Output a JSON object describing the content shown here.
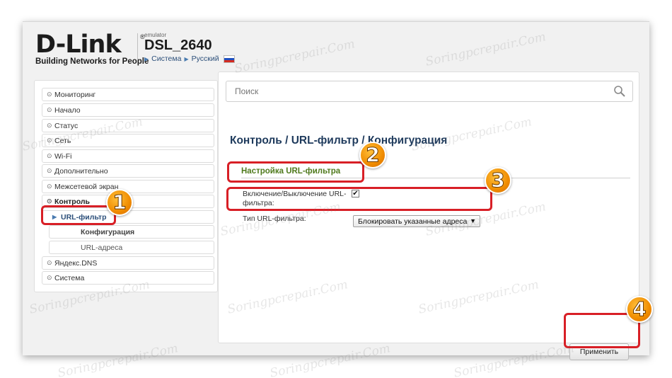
{
  "header": {
    "logo_text": "D-Link",
    "logo_reg": "®",
    "tagline": "Building Networks for People",
    "emulator_label": "emulator",
    "model": "DSL_2640",
    "links": [
      "Система",
      "Русский"
    ]
  },
  "search": {
    "placeholder": "Поиск"
  },
  "sidebar": {
    "items": [
      {
        "label": "Мониторинг"
      },
      {
        "label": "Начало"
      },
      {
        "label": "Статус"
      },
      {
        "label": "Сеть"
      },
      {
        "label": "Wi-Fi"
      },
      {
        "label": "Дополнительно"
      },
      {
        "label": "Межсетевой экран"
      },
      {
        "label": "Контроль"
      }
    ],
    "sub_item": "URL-фильтр",
    "sub_sub_items": [
      "Конфигурация",
      "URL-адреса"
    ],
    "items_after": [
      {
        "label": "Яндекс.DNS"
      },
      {
        "label": "Система"
      }
    ]
  },
  "main": {
    "title": "Контроль /  URL-фильтр /  Конфигурация",
    "section_title": "Настройка URL-фильтра",
    "toggle_label": "Включение/Выключение URL-фильтра:",
    "toggle_checked": true,
    "type_label": "Тип URL-фильтра:",
    "type_value": "Блокировать указанные адреса",
    "apply_label": "Применить"
  },
  "annotations": {
    "badges": [
      "1",
      "2",
      "3",
      "4"
    ],
    "highlight_color": "#d81f26",
    "badge_color": "#f08c00"
  },
  "watermark": "Soringpcrepair.Com",
  "colors": {
    "title_blue": "#1e3a5c",
    "section_green": "#4f7a1c",
    "link_blue": "#2c4f7a"
  }
}
